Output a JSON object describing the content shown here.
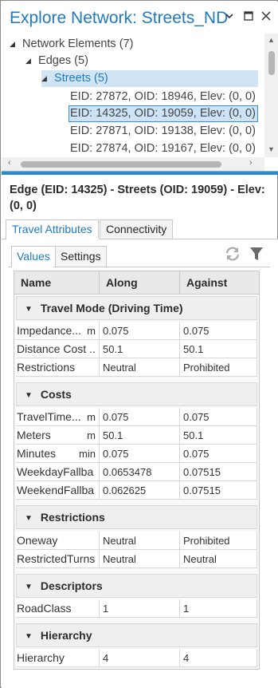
{
  "window": {
    "title": "Explore Network: Streets_ND",
    "pin_icon": "dropdown-icon",
    "maximize_icon": "maximize-icon",
    "close_icon": "close-icon"
  },
  "tree": {
    "root": "Network Elements (7)",
    "edges": "Edges (5)",
    "streets": "Streets (5)",
    "items": [
      "EID: 27872, OID: 18946, Elev: (0, 0)",
      "EID: 14325, OID: 19059, Elev: (0, 0)",
      "EID: 27871, OID: 19138, Elev: (0, 0)",
      "EID: 27874, OID: 19167, Elev: (0, 0)"
    ]
  },
  "details": {
    "header": "Edge (EID: 14325) - Streets (OID: 19059) - Elev: (0, 0)",
    "tabs": [
      "Travel Attributes",
      "Connectivity"
    ],
    "subtabs": [
      "Values",
      "Settings"
    ]
  },
  "grid": {
    "columns": [
      "Name",
      "Along",
      "Against"
    ],
    "groups": [
      {
        "title": "Travel Mode (Driving Time)",
        "rows": [
          {
            "name": "Impedance...",
            "unit": "m",
            "along": "0.075",
            "against": "0.075"
          },
          {
            "name": "Distance Cost ..",
            "unit": "",
            "along": "50.1",
            "against": "50.1"
          },
          {
            "name": "Restrictions",
            "unit": "",
            "along": "Neutral",
            "against": "Prohibited"
          }
        ]
      },
      {
        "title": "Costs",
        "rows": [
          {
            "name": "TravelTime...",
            "unit": "m",
            "along": "0.075",
            "against": "0.075"
          },
          {
            "name": "Meters",
            "unit": "m",
            "along": "50.1",
            "against": "50.1"
          },
          {
            "name": "Minutes",
            "unit": "min",
            "along": "0.075",
            "against": "0.075"
          },
          {
            "name": "WeekdayFallba",
            "unit": "",
            "along": "0.0653478",
            "against": "0.07515"
          },
          {
            "name": "WeekendFallba",
            "unit": "",
            "along": "0.062625",
            "against": "0.07515"
          }
        ]
      },
      {
        "title": "Restrictions",
        "rows": [
          {
            "name": "Oneway",
            "unit": "",
            "along": "Neutral",
            "against": "Prohibited"
          },
          {
            "name": "RestrictedTurns",
            "unit": "",
            "along": "Neutral",
            "against": "Neutral"
          }
        ]
      },
      {
        "title": "Descriptors",
        "rows": [
          {
            "name": "RoadClass",
            "unit": "",
            "along": "1",
            "against": "1"
          }
        ]
      },
      {
        "title": "Hierarchy",
        "rows": [
          {
            "name": "Hierarchy",
            "unit": "",
            "along": "4",
            "against": "4"
          }
        ]
      }
    ]
  },
  "colors": {
    "accent": "#1e7bc2",
    "selection": "#cde3f7",
    "splitter": "#2d89c8"
  }
}
